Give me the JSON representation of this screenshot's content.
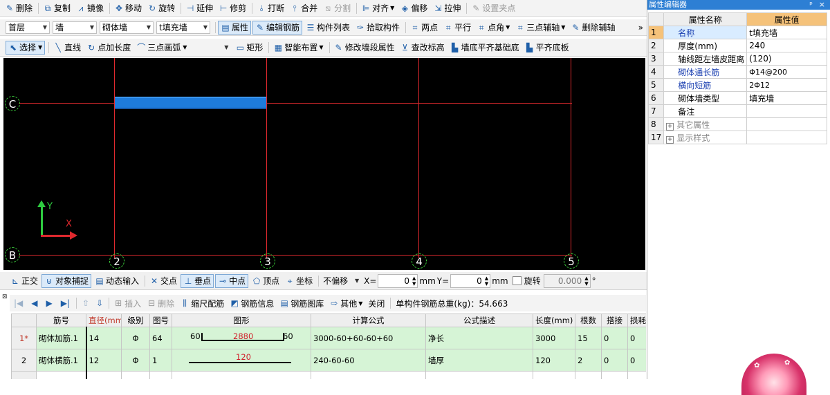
{
  "toolbar1": {
    "items": [
      {
        "label": "删除",
        "icon": "eraser-icon",
        "glyph": "✎"
      },
      {
        "label": "复制",
        "icon": "copy-icon",
        "glyph": "⧉"
      },
      {
        "label": "镜像",
        "icon": "mirror-icon",
        "glyph": "⩘"
      },
      {
        "label": "移动",
        "icon": "move-icon",
        "glyph": "✥"
      },
      {
        "label": "旋转",
        "icon": "rotate-icon",
        "glyph": "↻"
      },
      {
        "label": "延伸",
        "icon": "extend-icon",
        "glyph": "⊣"
      },
      {
        "label": "修剪",
        "icon": "trim-icon",
        "glyph": "⊢"
      },
      {
        "label": "打断",
        "icon": "break-icon",
        "glyph": "⫰"
      },
      {
        "label": "合并",
        "icon": "merge-icon",
        "glyph": "⫯"
      },
      {
        "label": "分割",
        "icon": "split-icon",
        "glyph": "⧅",
        "disabled": true
      },
      {
        "label": "对齐",
        "icon": "align-icon",
        "glyph": "⊫",
        "dropdown": true
      },
      {
        "label": "偏移",
        "icon": "offset-icon",
        "glyph": "◈"
      },
      {
        "label": "拉伸",
        "icon": "stretch-icon",
        "glyph": "⇲"
      },
      {
        "label": "设置夹点",
        "icon": "grip-icon",
        "glyph": "✎",
        "disabled": true
      }
    ]
  },
  "toolbar2": {
    "floor": "首层",
    "category": "墙",
    "subcategory": "砌体墙",
    "component": "t填充墙",
    "buttons": [
      {
        "label": "属性",
        "icon": "property-icon",
        "glyph": "▤",
        "active": true
      },
      {
        "label": "编辑钢筋",
        "icon": "edit-rebar-icon",
        "glyph": "✎",
        "active": true
      },
      {
        "label": "构件列表",
        "icon": "component-list-icon",
        "glyph": "☰"
      },
      {
        "label": "拾取构件",
        "icon": "pick-icon",
        "glyph": "✑"
      },
      {
        "label": "两点",
        "icon": "two-point-icon",
        "glyph": "⌗"
      },
      {
        "label": "平行",
        "icon": "parallel-icon",
        "glyph": "⌗"
      },
      {
        "label": "点角",
        "icon": "point-angle-icon",
        "glyph": "⌗",
        "dropdown": true
      },
      {
        "label": "三点辅轴",
        "icon": "three-point-axis-icon",
        "glyph": "⌗",
        "dropdown": true
      },
      {
        "label": "删除辅轴",
        "icon": "delete-axis-icon",
        "glyph": "✎"
      }
    ]
  },
  "toolbar3": {
    "select": "选择",
    "line": "直线",
    "point_length": "点加长度",
    "arc": "三点画弧",
    "arc_combo": "",
    "rect": "矩形",
    "smart": "智能布置",
    "modify": "修改墙段属性",
    "elevation": "查改标高",
    "align_foundation": "墙底平齐基础底",
    "align_slab": "平齐底板"
  },
  "canvas": {
    "axes_v": [
      "2",
      "3",
      "4",
      "5"
    ],
    "axes_h": [
      "C",
      "B"
    ],
    "coord_x": "X",
    "coord_y": "Y",
    "colors": {
      "background": "#000000",
      "axis": "#e0292e",
      "wall": "#1e7bdb",
      "ucs_x": "#e0292e",
      "ucs_y": "#2ecc40"
    }
  },
  "snapbar": {
    "ortho": "正交",
    "snap": "对象捕捉",
    "dyn": "动态输入",
    "intersect": "交点",
    "perp": "垂点",
    "mid": "中点",
    "vertex": "顶点",
    "coord": "坐标",
    "offset_mode": "不偏移",
    "x_label": "X=",
    "x_value": "0",
    "unit1": "mm",
    "y_label": "Y=",
    "y_value": "0",
    "unit2": "mm",
    "rotate_label": "旋转",
    "rotate_value": "0.000",
    "deg": "°"
  },
  "rebar_toolbar": {
    "insert": "插入",
    "delete": "删除",
    "scale": "缩尺配筋",
    "info": "钢筋信息",
    "library": "钢筋图库",
    "other": "其他",
    "close": "关闭",
    "total": "单构件钢筋总重(kg)：54.663"
  },
  "rebar_table": {
    "headers": [
      "",
      "筋号",
      "直径(mm)",
      "级别",
      "图号",
      "图形",
      "计算公式",
      "公式描述",
      "长度(mm)",
      "根数",
      "搭接",
      "损耗"
    ],
    "rows": [
      {
        "num": "1*",
        "name": "砌体加筋.1",
        "dia": "14",
        "grade": "Φ",
        "fig": "64",
        "shape_left": "60",
        "shape_mid": "2880",
        "shape_right": "60",
        "formula": "3000-60+60-60+60",
        "desc": "净长",
        "len": "3000",
        "count": "15",
        "lap": "0",
        "loss": "0"
      },
      {
        "num": "2",
        "name": "砌体横筋.1",
        "dia": "12",
        "grade": "Φ",
        "fig": "1",
        "shape_left": "",
        "shape_mid": "120",
        "shape_right": "",
        "formula": "240-60-60",
        "desc": "墙厚",
        "len": "120",
        "count": "2",
        "lap": "0",
        "loss": "0"
      },
      {
        "num": "3",
        "name": "",
        "dia": "",
        "grade": "",
        "fig": "",
        "shape_left": "",
        "shape_mid": "",
        "shape_right": "",
        "formula": "",
        "desc": "",
        "len": "",
        "count": "",
        "lap": "",
        "loss": ""
      }
    ]
  },
  "prop_panel": {
    "title": "属性编辑器",
    "pin": "ᵖ",
    "close": "×",
    "head_name": "属性名称",
    "head_value": "属性值",
    "rows": [
      {
        "n": "1",
        "name": "名称",
        "value": "t填充墙",
        "blue": true
      },
      {
        "n": "2",
        "name": "厚度(mm)",
        "value": "240"
      },
      {
        "n": "3",
        "name": "轴线距左墙皮距离",
        "value": "(120)"
      },
      {
        "n": "4",
        "name": "砌体通长筋",
        "value": "Φ14@200",
        "blue": true
      },
      {
        "n": "5",
        "name": "横向短筋",
        "value": "2Φ12",
        "blue": true
      },
      {
        "n": "6",
        "name": "砌体墙类型",
        "value": "填充墙"
      },
      {
        "n": "7",
        "name": "备注",
        "value": ""
      },
      {
        "n": "8",
        "name": "其它属性",
        "value": "",
        "expand": true,
        "gray": true
      },
      {
        "n": "17",
        "name": "显示样式",
        "value": "",
        "expand": true,
        "gray": true
      }
    ]
  }
}
